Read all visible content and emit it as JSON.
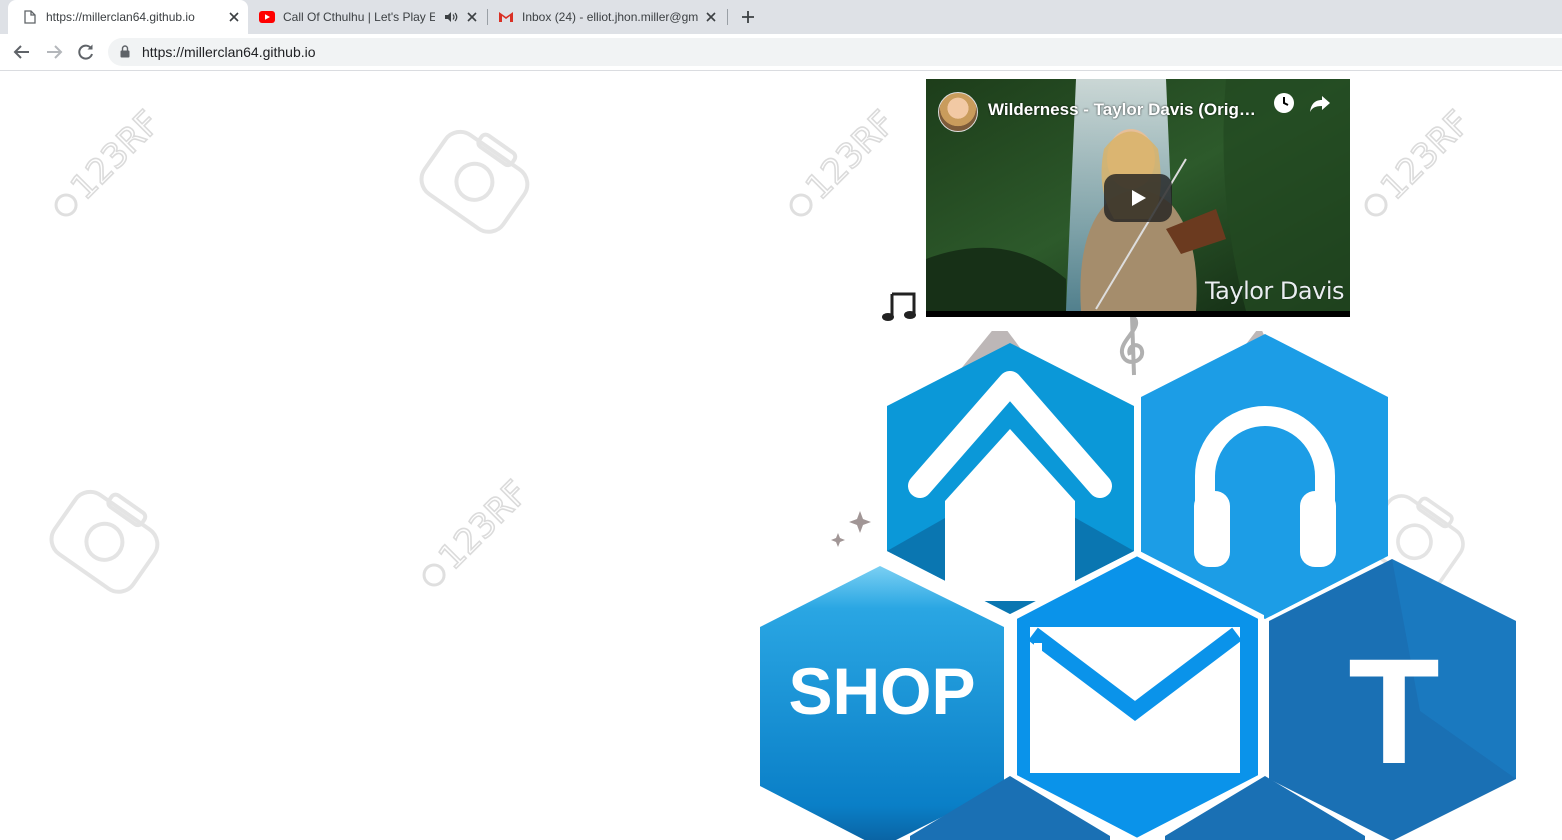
{
  "browser": {
    "tabs": [
      {
        "title": "https://millerclan64.github.io",
        "active": true,
        "icon": "page-icon"
      },
      {
        "title": "Call Of Cthulhu | Let's Play Ep",
        "active": false,
        "icon": "youtube-icon",
        "audio": true
      },
      {
        "title": "Inbox (24) - elliot.jhon.miller@gm",
        "active": false,
        "icon": "gmail-icon"
      }
    ],
    "address": "https://millerclan64.github.io"
  },
  "video": {
    "title": "Wilderness - Taylor Davis (Origin...",
    "watermark": "Taylor Davis",
    "icons": [
      "watch-later-icon",
      "share-icon",
      "play-icon"
    ]
  },
  "hex_menu": {
    "shop_label": "SHOP",
    "text_letter": "T",
    "items": [
      "home-hex",
      "headphones-hex",
      "shop-hex",
      "mail-hex",
      "text-hex"
    ],
    "colors": {
      "blue_dark": "#1a70b4",
      "blue_mid": "#1c9de6",
      "blue_light": "#0b98d8",
      "shop": "#1595d8"
    }
  },
  "watermark_text": "123RF"
}
